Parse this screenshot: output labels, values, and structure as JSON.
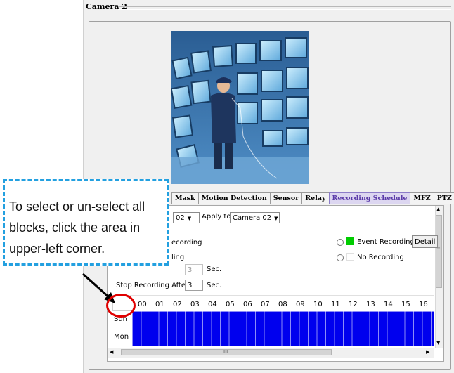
{
  "panel": {
    "title": "Camera 2"
  },
  "tabs": [
    {
      "label": "Mask",
      "active": false
    },
    {
      "label": "Motion Detection",
      "active": false
    },
    {
      "label": "Sensor",
      "active": false
    },
    {
      "label": "Relay",
      "active": false
    },
    {
      "label": "Recording Schedule",
      "active": true
    },
    {
      "label": "MFZ",
      "active": false
    },
    {
      "label": "PTZ",
      "active": false
    }
  ],
  "schedule": {
    "selected_value": "02",
    "apply_to_label": "Apply to",
    "apply_to_value": "Camera 02",
    "option_recording_partial": "ecording",
    "option_ling_partial": "ling",
    "pre_value": "3",
    "sec_label_1": "Sec.",
    "stop_label": "Stop Recording After",
    "stop_value": "3",
    "sec_label_2": "Sec.",
    "event_recording_label": "Event Recording",
    "event_recording_color": "#00cc00",
    "detail_button": "Detail",
    "no_recording_label": "No Recording",
    "hours": [
      "00",
      "01",
      "02",
      "03",
      "04",
      "05",
      "06",
      "07",
      "08",
      "09",
      "10",
      "11",
      "12",
      "13",
      "14",
      "15",
      "16"
    ],
    "days": [
      "Sun",
      "Mon"
    ],
    "grid_color": "#0000ee",
    "hscroll_thumb_label": "III"
  },
  "callout": {
    "lines": [
      "To select or un-select all",
      "blocks, click the area in",
      "upper-left corner."
    ],
    "border_color": "#23a0e0",
    "circle_color": "#e00000"
  }
}
